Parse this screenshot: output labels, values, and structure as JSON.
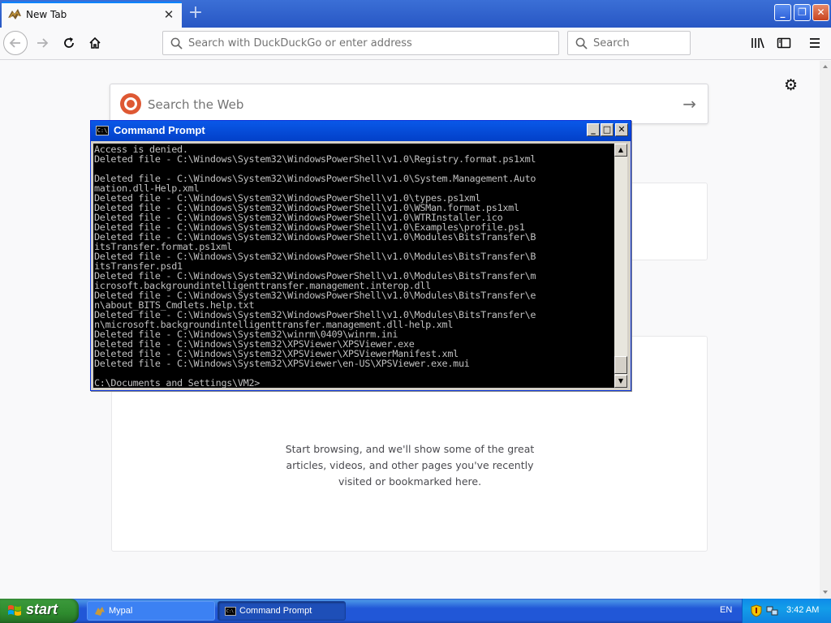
{
  "browser": {
    "tab_title": "New Tab",
    "url_placeholder": "Search with DuckDuckGo or enter address",
    "search_placeholder": "Search"
  },
  "newtab": {
    "web_search_placeholder": "Search the Web",
    "empty_message": "Start browsing, and we'll show some of the great articles, videos, and other pages you've recently visited or bookmarked here."
  },
  "cmd": {
    "title": "Command Prompt",
    "lines": [
      "Access is denied.",
      "Deleted file - C:\\Windows\\System32\\WindowsPowerShell\\v1.0\\Registry.format.ps1xml",
      "",
      "Deleted file - C:\\Windows\\System32\\WindowsPowerShell\\v1.0\\System.Management.Auto",
      "mation.dll-Help.xml",
      "Deleted file - C:\\Windows\\System32\\WindowsPowerShell\\v1.0\\types.ps1xml",
      "Deleted file - C:\\Windows\\System32\\WindowsPowerShell\\v1.0\\WSMan.format.ps1xml",
      "Deleted file - C:\\Windows\\System32\\WindowsPowerShell\\v1.0\\WTRInstaller.ico",
      "Deleted file - C:\\Windows\\System32\\WindowsPowerShell\\v1.0\\Examples\\profile.ps1",
      "Deleted file - C:\\Windows\\System32\\WindowsPowerShell\\v1.0\\Modules\\BitsTransfer\\B",
      "itsTransfer.format.ps1xml",
      "Deleted file - C:\\Windows\\System32\\WindowsPowerShell\\v1.0\\Modules\\BitsTransfer\\B",
      "itsTransfer.psd1",
      "Deleted file - C:\\Windows\\System32\\WindowsPowerShell\\v1.0\\Modules\\BitsTransfer\\m",
      "icrosoft.backgroundintelligenttransfer.management.interop.dll",
      "Deleted file - C:\\Windows\\System32\\WindowsPowerShell\\v1.0\\Modules\\BitsTransfer\\e",
      "n\\about_BITS_Cmdlets.help.txt",
      "Deleted file - C:\\Windows\\System32\\WindowsPowerShell\\v1.0\\Modules\\BitsTransfer\\e",
      "n\\microsoft.backgroundintelligenttransfer.management.dll-help.xml",
      "Deleted file - C:\\Windows\\System32\\winrm\\0409\\winrm.ini",
      "Deleted file - C:\\Windows\\System32\\XPSViewer\\XPSViewer.exe",
      "Deleted file - C:\\Windows\\System32\\XPSViewer\\XPSViewerManifest.xml",
      "Deleted file - C:\\Windows\\System32\\XPSViewer\\en-US\\XPSViewer.exe.mui",
      "",
      "C:\\Documents and Settings\\VM2>"
    ]
  },
  "taskbar": {
    "start_label": "start",
    "tasks": [
      {
        "label": "Mypal"
      },
      {
        "label": "Command Prompt"
      }
    ],
    "language": "EN",
    "clock": "3:42 AM"
  }
}
